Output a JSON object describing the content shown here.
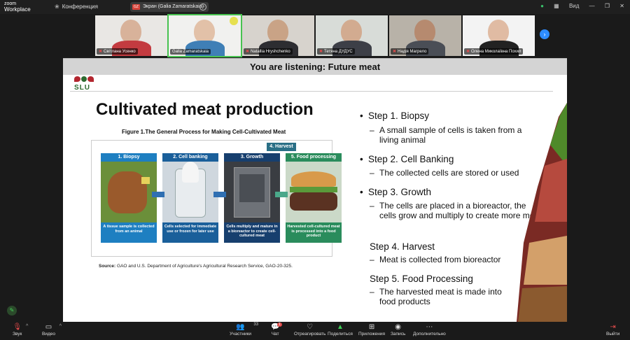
{
  "app": {
    "brand_line1": "zoom",
    "brand_line2": "Workplace",
    "meeting_tab": "Конференция",
    "share_tab": "Экран (Galia Zamaratskaia)",
    "share_tab_badge": "GZ",
    "view_label": "Вид"
  },
  "participants": [
    {
      "name": "Світлана Усенко",
      "muted": true
    },
    {
      "name": "Galia Zamaratskaia",
      "muted": false,
      "active": true
    },
    {
      "name": "Natallia Hryshchenko",
      "muted": true
    },
    {
      "name": "Тетяна ДУДУС",
      "muted": true
    },
    {
      "name": "Надія Магрело",
      "muted": true
    },
    {
      "name": "Олена Миколаївна Похил",
      "muted": true
    }
  ],
  "listening_banner": "You are listening: Future meat",
  "slide": {
    "logo_text": "SLU",
    "title": "Cultivated meat production",
    "figure_title": "Figure 1.The General Process for Making Cell-Cultivated Meat",
    "harvest_tag": "4. Harvest",
    "figure_steps": [
      {
        "header": "1. Biopsy",
        "caption": "A tissue sample is collected from an animal",
        "color": "#1e7fc1"
      },
      {
        "header": "2. Cell banking",
        "caption": "Cells selected for immediate use or frozen for later use",
        "color": "#1a5f9a"
      },
      {
        "header": "3. Growth",
        "caption": "Cells multiply and mature in a bioreactor to create cell-cultured meat",
        "color": "#173f6e"
      },
      {
        "header": "5. Food processing",
        "caption": "Harvested cell-cultured meat is processed into a food product",
        "color": "#2a8c5c"
      }
    ],
    "source_label": "Source:",
    "source_text": "GAO and U.S. Department of Agriculture's Agricultural Research Service, GAO-20-325.",
    "bullets": [
      {
        "title": "Step 1. Biopsy",
        "detail": "A small sample of cells is taken from a living animal"
      },
      {
        "title": "Step 2. Cell Banking",
        "detail": "The collected cells are stored or used"
      },
      {
        "title": "Step 3. Growth",
        "detail": "The cells are placed in a bioreactor, the cells grow and multiply to create more meat"
      },
      {
        "title": "Step 4. Harvest",
        "detail": "Meat is collected from bioreactor"
      },
      {
        "title": "Step 5. Food Processing",
        "detail": "The harvested meat is made into food products"
      }
    ]
  },
  "toolbar": {
    "audio": "Звук",
    "video": "Видео",
    "participants": "Участники",
    "participants_count": "33",
    "chat": "Чат",
    "chat_badge": "1",
    "react": "Отреагировать",
    "share": "Поделиться",
    "apps": "Приложения",
    "record": "Запись",
    "more": "Дополнительно",
    "leave": "Выйти"
  },
  "colors": {
    "active_border": "#47c24f",
    "muted_red": "#e14b4b",
    "zoom_blue": "#2d8cff",
    "share_green": "#3ccf55"
  }
}
